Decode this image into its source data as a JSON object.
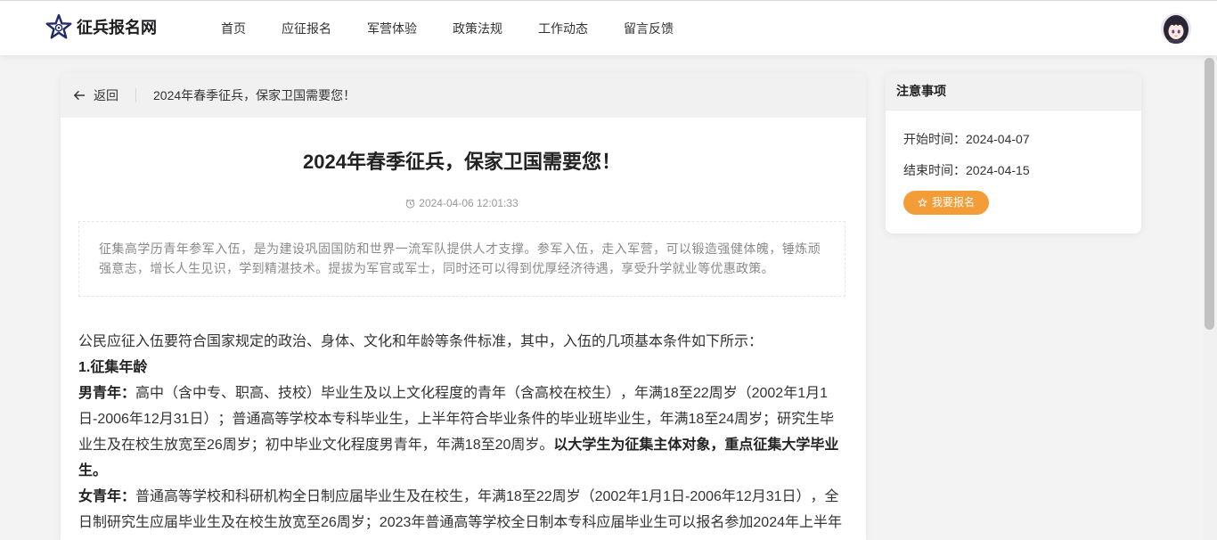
{
  "site": {
    "name": "征兵报名网",
    "logo_icon": "star-emblem-icon"
  },
  "nav": {
    "items": [
      {
        "label": "首页"
      },
      {
        "label": "应征报名"
      },
      {
        "label": "军营体验"
      },
      {
        "label": "政策法规"
      },
      {
        "label": "工作动态"
      },
      {
        "label": "留言反馈"
      }
    ]
  },
  "user": {
    "avatar_icon": "user-avatar"
  },
  "breadcrumb": {
    "back_icon": "arrow-left-icon",
    "back_label": "返回",
    "current": "2024年春季征兵，保家卫国需要您！"
  },
  "article": {
    "title": "2024年春季征兵，保家卫国需要您！",
    "published_icon": "clock-icon",
    "published_at": "2024-04-06 12:01:33",
    "summary": "征集高学历青年参军入伍，是为建设巩固国防和世界一流军队提供人才支撑。参军入伍，走入军营，可以锻造强健体魄，锤炼顽强意志，增长人生见识，学到精湛技术。提拔为军官或军士，同时还可以得到优厚经济待遇，享受升学就业等优惠政策。",
    "intro": "公民应征入伍要符合国家规定的政治、身体、文化和年龄等条件标准，其中，入伍的几项基本条件如下所示：",
    "section_heading": "1.征集年龄",
    "male": {
      "label": "男青年：",
      "text": "高中（含中专、职高、技校）毕业生及以上文化程度的青年（含高校在校生），年满18至22周岁（2002年1月1日-2006年12月31日）；普通高等学校本专科毕业生，上半年符合毕业条件的毕业班毕业生，年满18至24周岁；研究生毕业生及在校生放宽至26周岁；初中毕业文化程度男青年，年满18至20周岁。",
      "emphasis": "以大学生为征集主体对象，重点征集大学毕业生。"
    },
    "female": {
      "label": "女青年：",
      "text": "普通高等学校和科研机构全日制应届毕业生及在校生，年满18至22周岁（2002年1月1日-2006年12月31日），全日制研究生应届毕业生及在校生放宽至26周岁；2023年普通高等学校全日制本专科应届毕业生可以报名参加2024年上半年"
    }
  },
  "notice": {
    "title": "注意事项",
    "start": {
      "label": "开始时间：",
      "value": "2024-04-07"
    },
    "end": {
      "label": "结束时间：",
      "value": "2024-04-15"
    },
    "signup_button": {
      "label": "我要报名",
      "icon": "star-outline-icon"
    }
  },
  "colors": {
    "page_background": "#f3f3f3",
    "accent_orange": "#f29d38",
    "logo_navy": "#1f2a6a",
    "text": "#333333",
    "muted_text": "#999999"
  }
}
